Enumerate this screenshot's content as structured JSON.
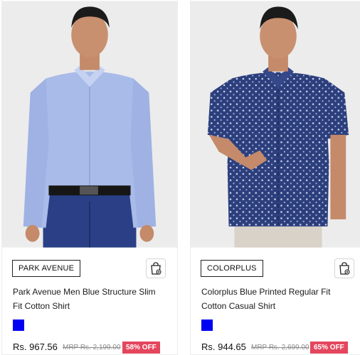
{
  "products": [
    {
      "brand": "PARK AVENUE",
      "title": "Park Avenue Men Blue Structure Slim Fit Cotton Shirt",
      "price": "Rs. 967.56",
      "mrp": "MRP Rs. 2,199.00",
      "discount": "58% OFF",
      "swatch_color": "#0000f2",
      "image_icon": "model-light-blue-shirt-image"
    },
    {
      "brand": "COLORPLUS",
      "title": "Colorplus Blue Printed Regular Fit Cotton Casual Shirt",
      "price": "Rs. 944.65",
      "mrp": "MRP Rs. 2,699.00",
      "discount": "65% OFF",
      "swatch_color": "#0000f2",
      "image_icon": "model-navy-printed-shirt-image"
    }
  ],
  "colors": {
    "discount_badge": "#e4465e",
    "swatch": "#0000f2"
  }
}
